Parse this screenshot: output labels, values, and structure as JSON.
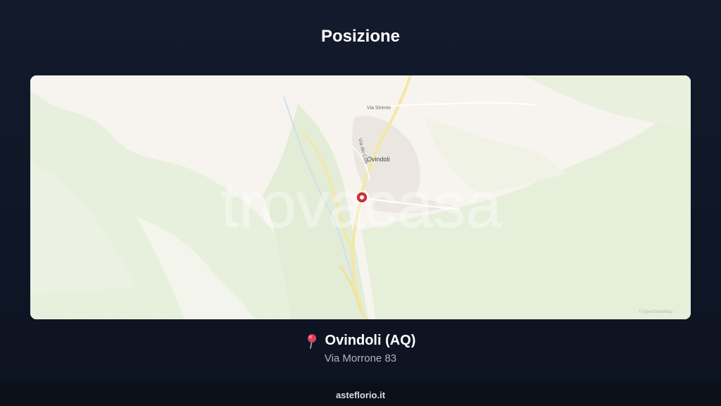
{
  "page": {
    "title": "Posizione"
  },
  "map": {
    "watermark": "trovacasa",
    "town_label": "Ovindoli",
    "street_labels": [
      "Via Sirente",
      "Via dei Colli"
    ],
    "attribution": "© OpenStreetMap",
    "marker_color": "#c8323f"
  },
  "location": {
    "pin_icon": "round-pushpin-icon",
    "name": "Ovindoli (AQ)",
    "address": "Via Morrone 83"
  },
  "footer": {
    "site": "asteflorio.it"
  },
  "colors": {
    "background": "#121a2c",
    "map_land": "#f7f4ef",
    "map_green": "#e7f0dc",
    "roads": "#f4e7a4"
  }
}
